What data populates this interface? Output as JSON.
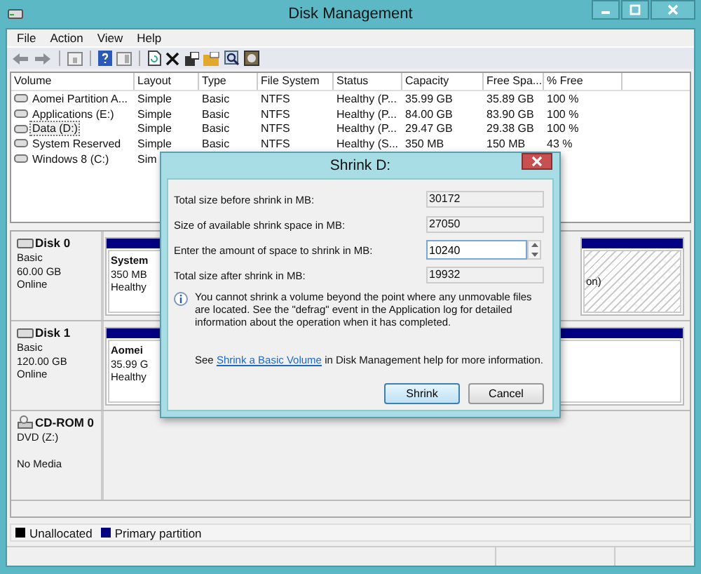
{
  "window": {
    "title": "Disk Management"
  },
  "menu": [
    "File",
    "Action",
    "View",
    "Help"
  ],
  "volumes": {
    "columns": [
      "Volume",
      "Layout",
      "Type",
      "File System",
      "Status",
      "Capacity",
      "Free Spa...",
      "% Free"
    ],
    "rows": [
      {
        "cells": [
          "Aomei Partition A...",
          "Simple",
          "Basic",
          "NTFS",
          "Healthy (P...",
          "35.99 GB",
          "35.89 GB",
          "100 %"
        ],
        "selected": false
      },
      {
        "cells": [
          "Applications (E:)",
          "Simple",
          "Basic",
          "NTFS",
          "Healthy (P...",
          "84.00 GB",
          "83.90 GB",
          "100 %"
        ],
        "selected": false
      },
      {
        "cells": [
          "Data (D:)",
          "Simple",
          "Basic",
          "NTFS",
          "Healthy (P...",
          "29.47 GB",
          "29.38 GB",
          "100 %"
        ],
        "selected": true
      },
      {
        "cells": [
          "System Reserved",
          "Simple",
          "Basic",
          "NTFS",
          "Healthy (S...",
          "350 MB",
          "150 MB",
          "43 %"
        ],
        "selected": false
      },
      {
        "cells": [
          "Windows 8 (C:)",
          "Sim"
        ],
        "selected": false
      }
    ]
  },
  "disks": [
    {
      "kind": "disk",
      "name": "Disk 0",
      "lines": [
        "Basic",
        "60.00 GB",
        "Online"
      ],
      "partition": [
        "System",
        "350 MB",
        "Healthy"
      ],
      "tail": "on)"
    },
    {
      "kind": "disk",
      "name": "Disk 1",
      "lines": [
        "Basic",
        "120.00 GB",
        "Online"
      ],
      "partition": [
        "Aomei",
        "35.99 G",
        "Healthy"
      ]
    },
    {
      "kind": "cdrom",
      "name": "CD-ROM 0",
      "lines": [
        "DVD (Z:)",
        "No Media"
      ]
    }
  ],
  "legend": [
    {
      "label": "Unallocated",
      "color": "#000000"
    },
    {
      "label": "Primary partition",
      "color": "#000080"
    }
  ],
  "dialog": {
    "title": "Shrink D:",
    "fields": [
      {
        "label": "Total size before shrink in MB:",
        "value": "30172",
        "kind": "readonly"
      },
      {
        "label": "Size of available shrink space in MB:",
        "value": "27050",
        "kind": "readonly"
      },
      {
        "label": "Enter the amount of space to shrink in MB:",
        "value": "10240",
        "kind": "spin"
      },
      {
        "label": "Total size after shrink in MB:",
        "value": "19932",
        "kind": "readonly"
      }
    ],
    "info": "You cannot shrink a volume beyond the point where any unmovable files are located. See the \"defrag\" event in the Application log for detailed information about the operation when it has completed.",
    "help": {
      "before": "See",
      "link": "Shrink a Basic Volume",
      "after": "in Disk Management help for more information."
    },
    "buttons": [
      {
        "label": "Shrink",
        "default": true
      },
      {
        "label": "Cancel",
        "default": false
      }
    ]
  }
}
